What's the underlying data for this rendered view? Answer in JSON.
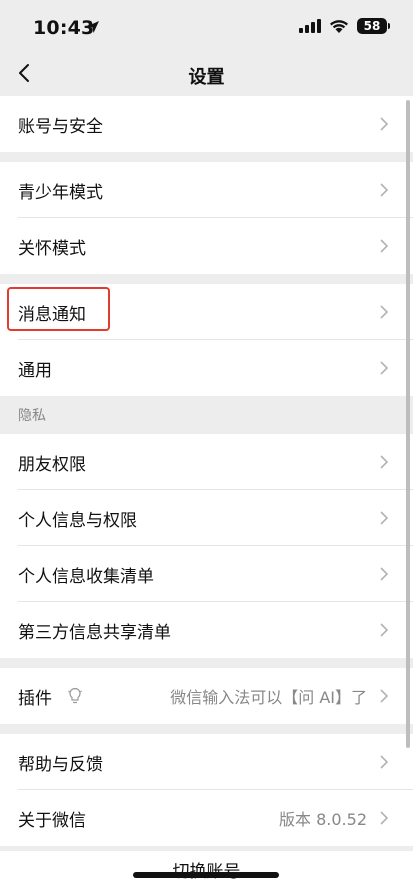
{
  "status_bar": {
    "time": "10:43",
    "battery": "58"
  },
  "nav": {
    "title": "设置"
  },
  "groups": {
    "account": {
      "label": "账号与安全"
    },
    "youth": {
      "label": "青少年模式"
    },
    "care": {
      "label": "关怀模式"
    },
    "notify": {
      "label": "消息通知"
    },
    "general": {
      "label": "通用"
    },
    "privacy_header": "隐私",
    "friends": {
      "label": "朋友权限"
    },
    "personal_info": {
      "label": "个人信息与权限"
    },
    "collect_list": {
      "label": "个人信息收集清单"
    },
    "third_party": {
      "label": "第三方信息共享清单"
    },
    "plugins": {
      "label": "插件",
      "value": "微信输入法可以【问 AI】了"
    },
    "help": {
      "label": "帮助与反馈"
    },
    "about": {
      "label": "关于微信",
      "value": "版本 8.0.52"
    },
    "switch_account": "切换账号"
  },
  "colors": {
    "highlight": "#e23b2f",
    "background": "#ededed"
  }
}
